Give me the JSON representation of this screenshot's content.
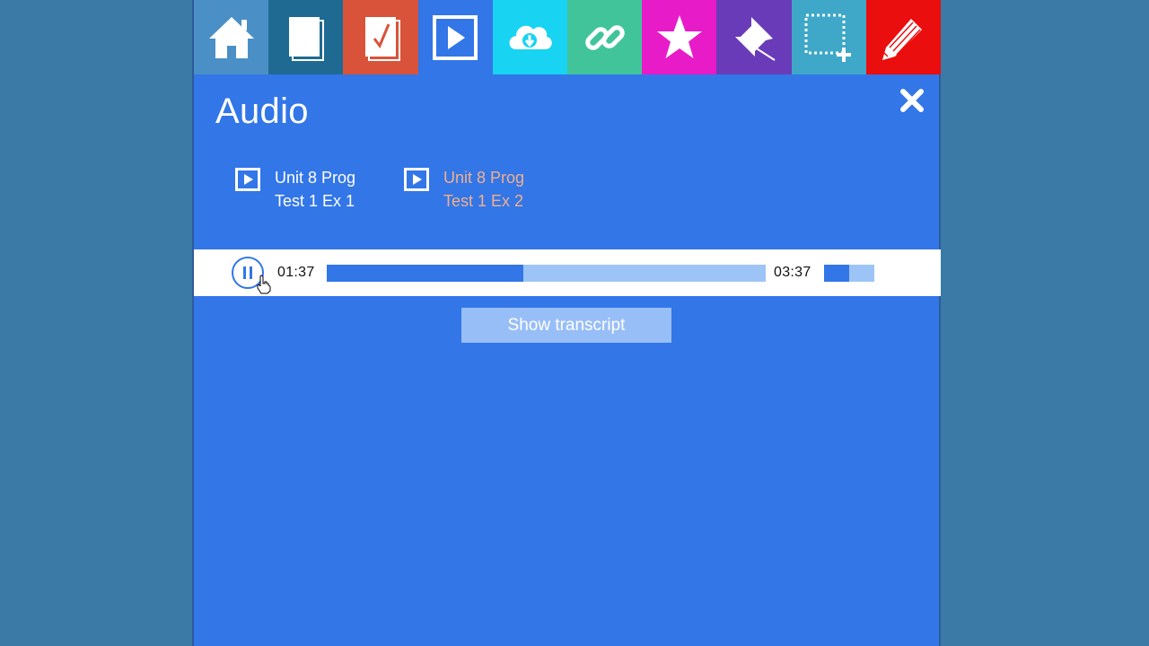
{
  "toolbar": {
    "tools": [
      {
        "name": "home-icon",
        "color": "#4a90c6"
      },
      {
        "name": "pages-icon",
        "color": "#1f6a92"
      },
      {
        "name": "test-check-icon",
        "color": "#d9533a"
      },
      {
        "name": "media-play-icon",
        "color": "#3276e8"
      },
      {
        "name": "cloud-download-icon",
        "color": "#18d3f2"
      },
      {
        "name": "link-icon",
        "color": "#42c49a"
      },
      {
        "name": "star-icon",
        "color": "#e81bc8"
      },
      {
        "name": "pin-icon",
        "color": "#6a3bb8"
      },
      {
        "name": "selection-add-icon",
        "color": "#3fa8c8"
      },
      {
        "name": "pencil-icon",
        "color": "#ea0e0e"
      }
    ]
  },
  "panel": {
    "title": "Audio",
    "close_icon": "close-icon"
  },
  "tracks": [
    {
      "label": "Unit 8 Prog\nTest 1 Ex 1",
      "color": "#ffffff",
      "active": false
    },
    {
      "label": "Unit 8 Prog\nTest 1 Ex 2",
      "color": "#f0b08a",
      "active": true
    }
  ],
  "player": {
    "current_time": "01:37",
    "total_time": "03:37",
    "progress_fraction": 0.447,
    "volume_fraction": 0.5,
    "state": "playing"
  },
  "transcript_button": {
    "label": "Show transcript"
  },
  "colors": {
    "panel_bg": "#3276e8",
    "page_bg": "#3b7aa7",
    "progress_played": "#3276e8",
    "progress_remaining": "#9dc4f6"
  }
}
